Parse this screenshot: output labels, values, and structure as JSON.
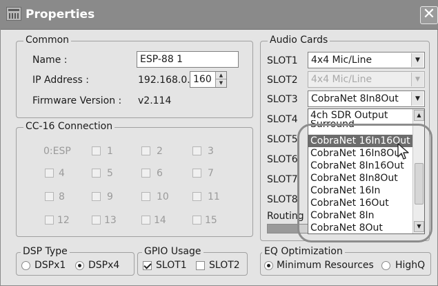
{
  "window": {
    "title": "Properties",
    "icon": "properties-window-icon",
    "close": "✕"
  },
  "common": {
    "label": "Common",
    "name_label": "Name :",
    "name_value": "ESP-88 1",
    "ip_label": "IP Address :",
    "ip_prefix": "192.168.0.",
    "ip_last": "160",
    "fw_label": "Firmware Version :",
    "fw_value": "v2.114"
  },
  "cc16": {
    "label": "CC-16 Connection",
    "esp_label": "0:ESP",
    "ports": [
      "1",
      "2",
      "3",
      "4",
      "5",
      "6",
      "7",
      "8",
      "9",
      "10",
      "11",
      "12",
      "13",
      "14",
      "15"
    ]
  },
  "audio_cards": {
    "label": "Audio Cards",
    "slots": [
      {
        "label": "SLOT1",
        "value": "4x4 Mic/Line",
        "enabled": true
      },
      {
        "label": "SLOT2",
        "value": "4x4 Mic/Line",
        "enabled": false
      },
      {
        "label": "SLOT3",
        "value": "CobraNet 8In8Out",
        "enabled": true
      },
      {
        "label": "SLOT4"
      },
      {
        "label": "SLOT5"
      },
      {
        "label": "SLOT6"
      },
      {
        "label": "SLOT7"
      },
      {
        "label": "SLOT8"
      }
    ],
    "routing_label": "Routing S",
    "routing_progress": 0.2
  },
  "dropdown": {
    "items": [
      "4ch SDR Output",
      "Surround",
      "CobraNet 16In16Out",
      "CobraNet 16In8Out",
      "CobraNet 8In16Out",
      "CobraNet 8In8Out",
      "CobraNet 16In",
      "CobraNet 16Out",
      "CobraNet 8In",
      "CobraNet 8Out"
    ],
    "highlighted_index": 2
  },
  "dsp_type": {
    "label": "DSP Type",
    "options": [
      "DSPx1",
      "DSPx4"
    ],
    "selected": "DSPx4"
  },
  "gpio": {
    "label": "GPIO Usage",
    "items": [
      {
        "label": "SLOT1",
        "checked": true
      },
      {
        "label": "SLOT2",
        "checked": false
      }
    ]
  },
  "eq": {
    "label": "EQ Optimization",
    "options": [
      "Minimum Resources",
      "HighQ"
    ],
    "selected": "Minimum Resources"
  },
  "colors": {
    "titlebar": "#8a8a8a",
    "highlight": "#6c6c6c",
    "window_bg": "#e4e4e4"
  }
}
